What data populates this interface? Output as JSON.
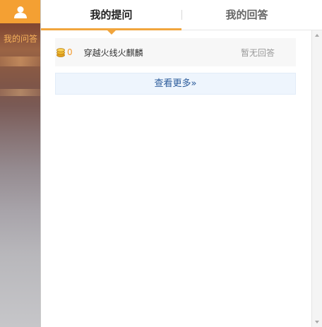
{
  "sidebar": {
    "avatar_icon": "user-icon",
    "items": [
      {
        "label": "我的问答"
      }
    ],
    "active_color": "#f7b25b",
    "avatar_bg": "#f4a033"
  },
  "tabs": [
    {
      "label": "我的提问",
      "active": true
    },
    {
      "label": "我的回答",
      "active": false
    }
  ],
  "accent_color": "#f1a53d",
  "questions": [
    {
      "reward_icon": "coin-icon",
      "reward": "0",
      "title": "穿越火线火麒麟",
      "status": "暂无回答"
    }
  ],
  "more_button": {
    "label": "查看更多»"
  }
}
